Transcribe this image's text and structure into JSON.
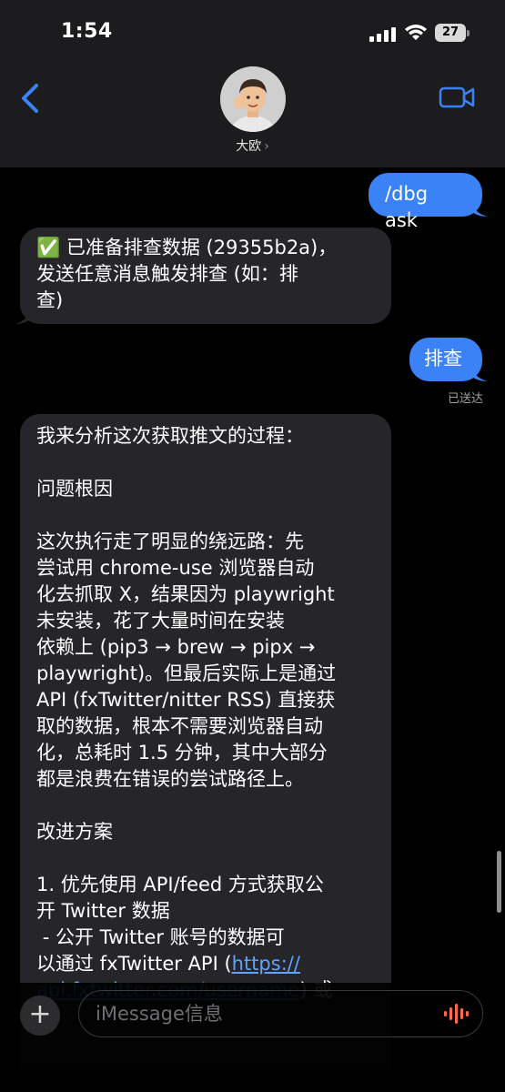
{
  "status_bar": {
    "time": "1:54",
    "battery": "27"
  },
  "header": {
    "contact_name": "大欧",
    "name_chevron": "›"
  },
  "messages": [
    {
      "type": "sent",
      "text": "/dbg ask"
    },
    {
      "type": "received",
      "text": "✅ 已准备排查数据 (29355b2a)，\n发送任意消息触发排查 (如：排\n查)"
    },
    {
      "type": "sent",
      "text": "排查"
    },
    {
      "type": "received",
      "text_before_link": "我来分析这次获取推文的过程：\n\n问题根因\n\n这次执行走了明显的绕远路：先\n尝试用 chrome-use 浏览器自动\n化去抓取 X，结果因为 playwright\n未安装，花了大量时间在安装\n依赖上 (pip3 → brew → pipx →\nplaywright)。但最后实际上是通过\nAPI (fxTwitter/nitter RSS) 直接获\n取的数据，根本不需要浏览器自动\n化，总耗时 1.5 分钟，其中大部分\n都是浪费在错误的尝试路径上。\n\n改进方案\n\n1. 优先使用 API/feed 方式获取公\n开 Twitter 数据\n - 公开 Twitter 账号的数据可\n以通过 fxTwitter API (",
      "link": "https://\napi.fxtwitter.com/username",
      "text_after_link": ") 或"
    }
  ],
  "delivered_label": "已送达",
  "input": {
    "placeholder": "iMessage信息",
    "plus": "+"
  },
  "colors": {
    "sent_bubble": "#3a82f6",
    "received_bubble": "#26262a",
    "accent": "#3a82f6",
    "audio": "#ff6b4a"
  }
}
